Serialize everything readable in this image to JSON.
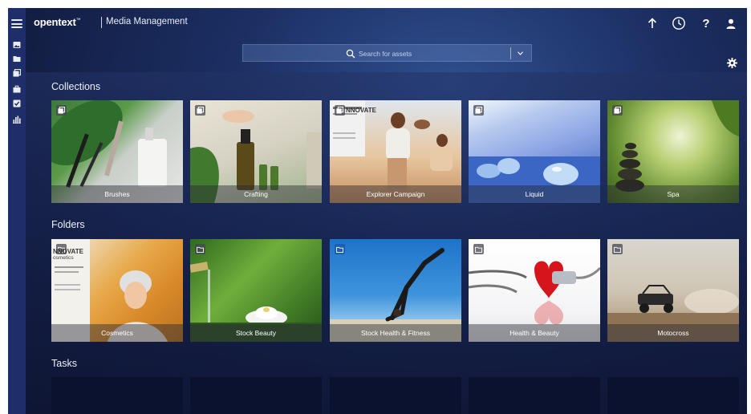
{
  "header": {
    "brand": "opentext",
    "brand_tm": "™",
    "app_title": "Media Management"
  },
  "search": {
    "placeholder": "Search for assets"
  },
  "sections": {
    "collections": "Collections",
    "folders": "Folders",
    "tasks": "Tasks"
  },
  "collections": [
    {
      "label": "Brushes"
    },
    {
      "label": "Crafting"
    },
    {
      "label": "Explorer Campaign"
    },
    {
      "label": "Liquid"
    },
    {
      "label": "Spa"
    }
  ],
  "folders": [
    {
      "label": "Cosmetics"
    },
    {
      "label": "Stock Beauty"
    },
    {
      "label": "Stock Health & Fitness"
    },
    {
      "label": "Health & Beauty"
    },
    {
      "label": "Motocross"
    }
  ],
  "thumb_text": {
    "innovate": "NNOVATE",
    "cosmetics": "osmetics"
  },
  "icons": {
    "menu": "hamburger-menu-icon",
    "rail": [
      "image-icon",
      "folder-icon",
      "collections-icon",
      "briefcase-icon",
      "tasks-check-icon",
      "chart-icon"
    ],
    "header": [
      "upload-icon",
      "history-icon",
      "help-icon",
      "user-icon"
    ],
    "search": "search-icon",
    "settings": "gear-icon"
  },
  "colors": {
    "rail": "#1f2e6b",
    "background": "#121d42",
    "folder_badge_selected": "#1d5fae"
  }
}
